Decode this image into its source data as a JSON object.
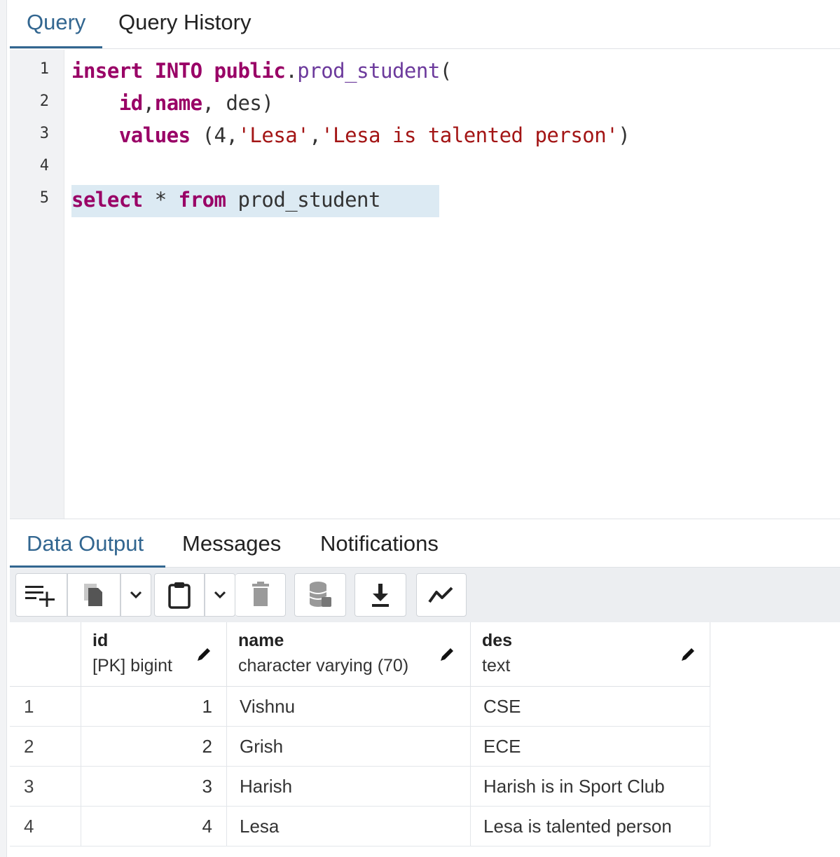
{
  "query_tabs": [
    {
      "label": "Query",
      "active": true
    },
    {
      "label": "Query History",
      "active": false
    }
  ],
  "editor": {
    "line_numbers": [
      "1",
      "2",
      "3",
      "4",
      "5"
    ],
    "lines": [
      [
        {
          "t": "insert",
          "c": "kw"
        },
        {
          "t": " ",
          "c": "plain"
        },
        {
          "t": "INTO",
          "c": "kw"
        },
        {
          "t": " ",
          "c": "plain"
        },
        {
          "t": "public",
          "c": "kw"
        },
        {
          "t": ".",
          "c": "plain"
        },
        {
          "t": "prod_student",
          "c": "fn"
        },
        {
          "t": "(",
          "c": "plain"
        }
      ],
      [
        {
          "t": "    ",
          "c": "plain"
        },
        {
          "t": "id",
          "c": "kw"
        },
        {
          "t": ",",
          "c": "plain"
        },
        {
          "t": "name",
          "c": "kw"
        },
        {
          "t": ", des)",
          "c": "plain"
        }
      ],
      [
        {
          "t": "    ",
          "c": "plain"
        },
        {
          "t": "values",
          "c": "kw"
        },
        {
          "t": " (4,",
          "c": "plain"
        },
        {
          "t": "'Lesa'",
          "c": "str"
        },
        {
          "t": ",",
          "c": "plain"
        },
        {
          "t": "'Lesa is talented person'",
          "c": "str"
        },
        {
          "t": ")",
          "c": "plain"
        }
      ],
      [],
      [
        {
          "t": "select",
          "c": "kw"
        },
        {
          "t": " * ",
          "c": "plain"
        },
        {
          "t": "from",
          "c": "kw"
        },
        {
          "t": " prod_student",
          "c": "plain"
        }
      ]
    ]
  },
  "output_tabs": [
    {
      "label": "Data Output",
      "active": true
    },
    {
      "label": "Messages",
      "active": false
    },
    {
      "label": "Notifications",
      "active": false
    }
  ],
  "toolbar": {
    "buttons": [
      "add-row-icon",
      "copy-icon",
      "chevron-down-icon",
      "paste-icon",
      "chevron-down-icon",
      "delete-icon",
      "save-data-icon",
      "download-icon",
      "graph-icon"
    ]
  },
  "grid": {
    "columns": [
      {
        "name": "id",
        "type": "[PK] bigint"
      },
      {
        "name": "name",
        "type": "character varying (70)"
      },
      {
        "name": "des",
        "type": "text"
      }
    ],
    "rows": [
      {
        "num": "1",
        "id": "1",
        "name": "Vishnu",
        "des": "CSE"
      },
      {
        "num": "2",
        "id": "2",
        "name": "Grish",
        "des": "ECE"
      },
      {
        "num": "3",
        "id": "3",
        "name": "Harish",
        "des": "Harish is in Sport Club"
      },
      {
        "num": "4",
        "id": "4",
        "name": "Lesa",
        "des": "Lesa is talented person"
      }
    ]
  },
  "colors": {
    "accent": "#326690",
    "keyword": "#990066",
    "string": "#a31515",
    "selection": "#dceaf3"
  }
}
